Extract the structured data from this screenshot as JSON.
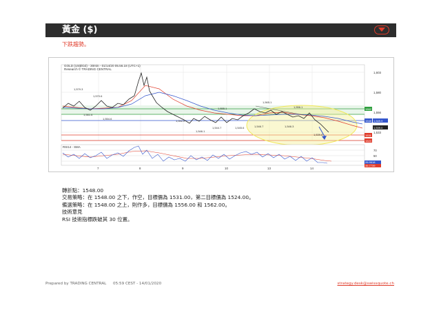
{
  "header": {
    "title": "黃金 ($)",
    "menu_icon": "chevron-down-icon"
  },
  "subtitle": "下跌趨勢。",
  "chart": {
    "instrument": "GOLD (US$/OZ) - 30min - 01/14/20 05.56.18 (UTC+1)",
    "provider": "Research © TRADING CENTRAL",
    "price_axis_labels": [
      "1,603",
      "1,580",
      "1,556",
      "1,533"
    ],
    "level_tags": [
      "1562",
      "1548",
      "1531",
      "1524"
    ],
    "current_price_tags": [
      "1,549.9",
      "1,539.0"
    ],
    "peak_labels": [
      "1,579.3",
      "1,570.6",
      "1,565.1",
      "1,555.1",
      "1,556.1"
    ],
    "trough_labels": [
      "1,561.6",
      "1,554.6",
      "1,552.0",
      "1,546.1",
      "1,544.7",
      "1,545.6",
      "1,546.7",
      "1,546.3",
      "1,539.8"
    ],
    "x_axis_labels": [
      "7",
      "8",
      "9",
      "10",
      "13",
      "14"
    ],
    "rsi_title": "RSI14 - SMA",
    "rsi_axis_labels": [
      "70",
      "50",
      "30"
    ],
    "rsi_tags": [
      "26.9618",
      "35.7739"
    ],
    "colors": {
      "level_green": "#2f9e3e",
      "level_blue": "#3355cc",
      "level_red": "#e03b2a",
      "highlight_yellow": "#f4ef9a",
      "price_line": "#222222",
      "rsi_line": "#3355cc",
      "rsi_sma": "#e03b2a"
    }
  },
  "analysis": {
    "pivot": "轉折點：1548.00",
    "strategy": "交易策略：在 1548.00 之下，作空，目標價為 1531.00，第二目標價為 1524.00。",
    "alternative": "備選策略：在 1548.00 之上，則作多，目標價為 1556.00 和 1562.00。",
    "comment_heading": "技術意見",
    "comment": "RSI 技術指標跌破其 30 位置。"
  },
  "footer": {
    "prepared_by": "Prepared by TRADING CENTRAL",
    "timestamp": "05:59 CEST - 14/01/2020",
    "contact": "strategy.desk@swissquote.ch"
  }
}
